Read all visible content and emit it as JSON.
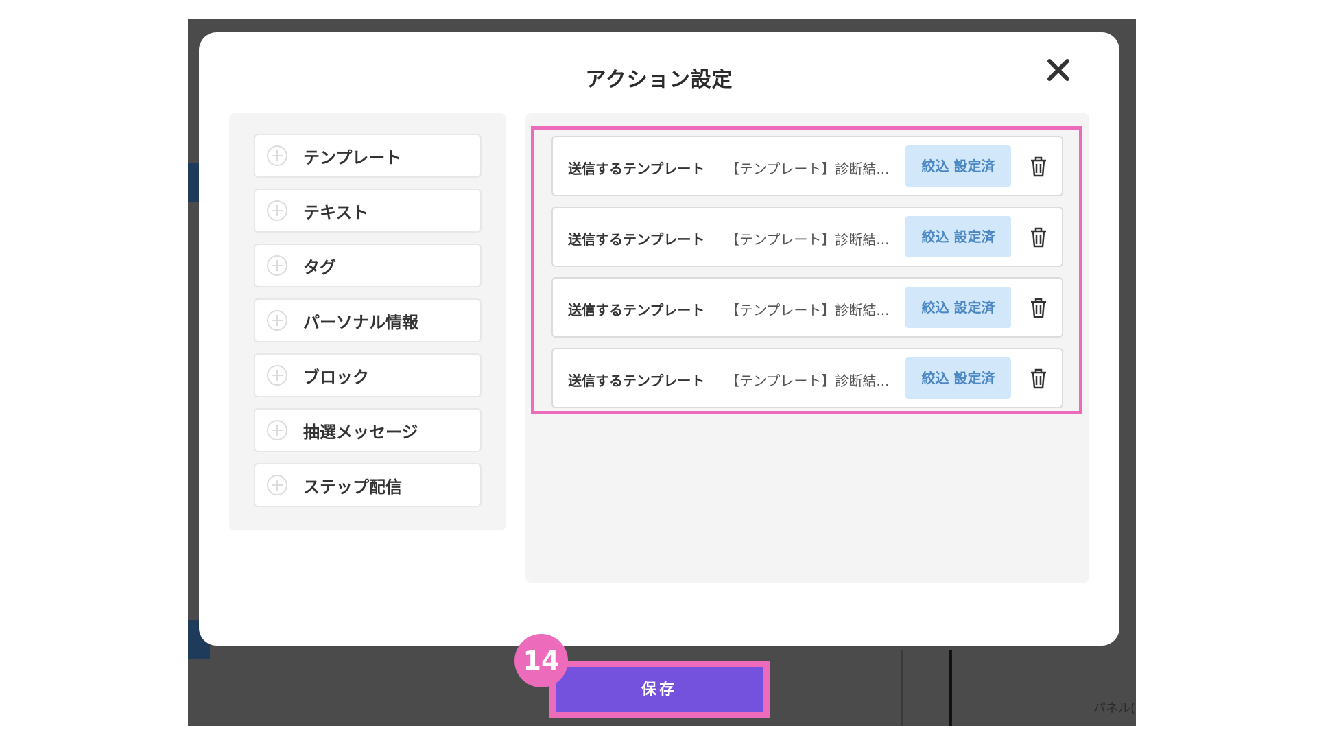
{
  "background": {
    "panel_label": "パネル("
  },
  "modal": {
    "title": "アクション設定",
    "close_icon": "close-icon",
    "actions": [
      {
        "label": "テンプレート"
      },
      {
        "label": "テキスト"
      },
      {
        "label": "タグ"
      },
      {
        "label": "パーソナル情報"
      },
      {
        "label": "ブロック"
      },
      {
        "label": "抽選メッセージ"
      },
      {
        "label": "ステップ配信"
      }
    ],
    "rows": [
      {
        "label": "送信するテンプレート",
        "value": "【テンプレート】診断結...",
        "filter": "絞込 設定済"
      },
      {
        "label": "送信するテンプレート",
        "value": "【テンプレート】診断結...",
        "filter": "絞込 設定済"
      },
      {
        "label": "送信するテンプレート",
        "value": "【テンプレート】診断結...",
        "filter": "絞込 設定済"
      },
      {
        "label": "送信するテンプレート",
        "value": "【テンプレート】診断結...",
        "filter": "絞込 設定済"
      }
    ]
  },
  "save": {
    "label": "保存",
    "step_number": "14"
  },
  "colors": {
    "accent_pink": "#ec6bbb",
    "save_purple": "#7452de",
    "filter_bg": "#d2e7f9",
    "filter_text": "#4a87c4"
  }
}
